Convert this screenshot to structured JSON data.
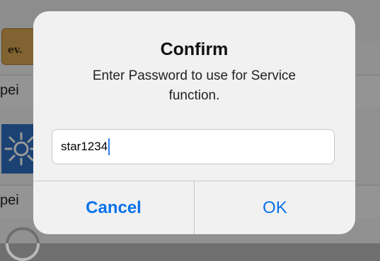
{
  "background": {
    "prev_button_label": "ev.",
    "rows": [
      "pei",
      "pei"
    ],
    "tile_icon": "sun-icon"
  },
  "alert": {
    "title": "Confirm",
    "message": "Enter Password to use for Service function.",
    "input_value": "star1234",
    "cancel_label": "Cancel",
    "ok_label": "OK",
    "colors": {
      "accent": "#0a72ea",
      "caret": "#2f7bf6"
    }
  }
}
